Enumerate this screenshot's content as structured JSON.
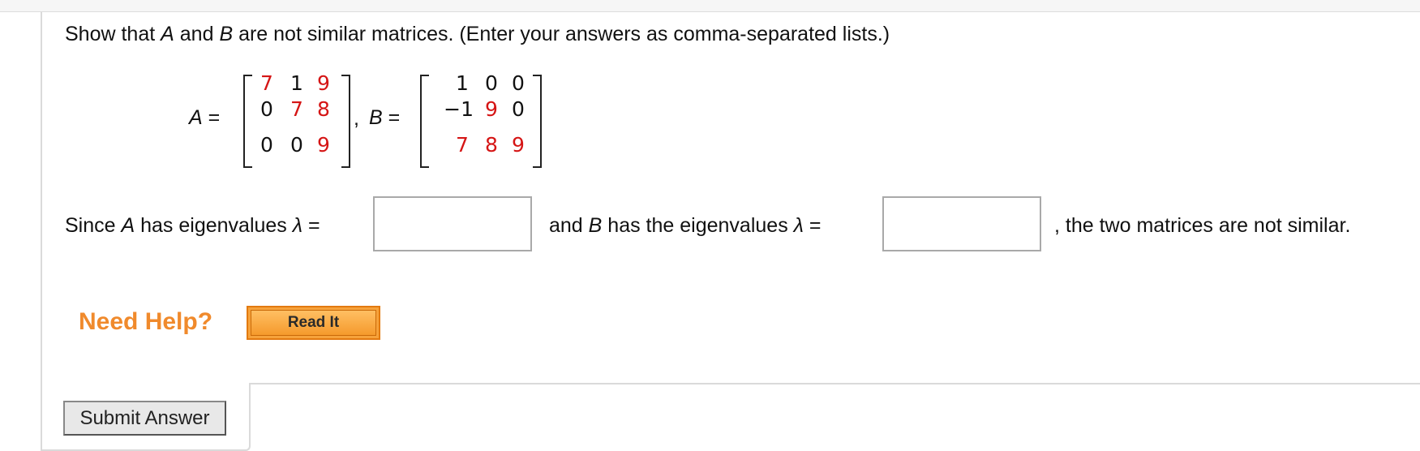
{
  "question": {
    "lead": "Show that ",
    "var_a": "A",
    "mid1": " and ",
    "var_b": "B",
    "rest": " are not similar matrices. (Enter your answers as comma-separated lists.)"
  },
  "matrices": {
    "a_label": "A",
    "b_label": "B",
    "equals": "=",
    "separator": ",",
    "a": [
      [
        "7",
        "1",
        "9"
      ],
      [
        "0",
        "7",
        "8"
      ],
      [
        "0",
        "0",
        "9"
      ]
    ],
    "b": [
      [
        "1",
        "0",
        "0"
      ],
      [
        "−1",
        "9",
        "0"
      ],
      [
        "7",
        "8",
        "9"
      ]
    ],
    "highlight_color": "#d51515"
  },
  "eigen": {
    "since": "Since ",
    "var_a": "A",
    "has_a": " has eigenvalues ",
    "lambda": "λ",
    "equals": " =",
    "and": "and ",
    "var_b": "B",
    "has_b": " has the eigenvalues ",
    "tail": ", the two matrices are not similar.",
    "answer_a_value": "",
    "answer_b_value": ""
  },
  "help": {
    "need_help": "Need Help?",
    "read_it": "Read It"
  },
  "submit_label": "Submit Answer"
}
